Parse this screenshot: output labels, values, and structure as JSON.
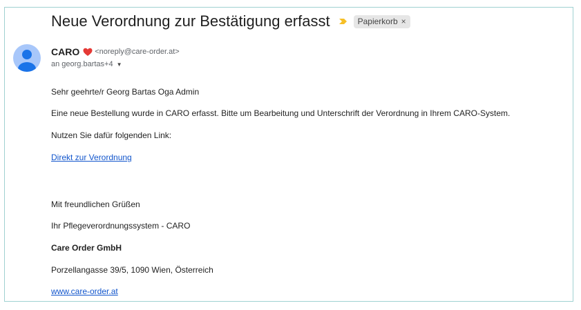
{
  "email": {
    "subject": "Neue Verordnung zur Bestätigung erfasst",
    "label": "Papierkorb",
    "label_remove": "×",
    "sender_name": "CARO",
    "sender_email": "<noreply@care-order.at>",
    "recipients": "an georg.bartas+4",
    "recipients_caret": "▼"
  },
  "body": {
    "greeting": "Sehr geehrte/r Georg Bartas Oga Admin",
    "intro": "Eine neue Bestellung wurde in CARO erfasst. Bitte um Bearbeitung und Unterschrift der Verordnung in Ihrem CARO-System.",
    "link_prompt": "Nutzen Sie dafür folgenden Link:",
    "link_text": "Direkt zur Verordnung",
    "closing": "Mit freundlichen Grüßen",
    "signature_system": "Ihr Pflegeverordnungssystem - CARO",
    "company": "Care Order GmbH",
    "address": "Porzellangasse 39/5, 1090 Wien, Österreich",
    "website": "www.care-order.at"
  },
  "colors": {
    "accent_link": "#1155cc",
    "importance_marker": "#f6bf26",
    "heart": "#e53935",
    "avatar_bg": "#a8c7fa",
    "avatar_fg": "#1a73e8",
    "frame_border": "#9fd1d1"
  },
  "icons": {
    "importance": "importance-marker-icon",
    "heart": "heart-icon",
    "avatar": "avatar-person-icon",
    "caret": "chevron-down-icon"
  }
}
